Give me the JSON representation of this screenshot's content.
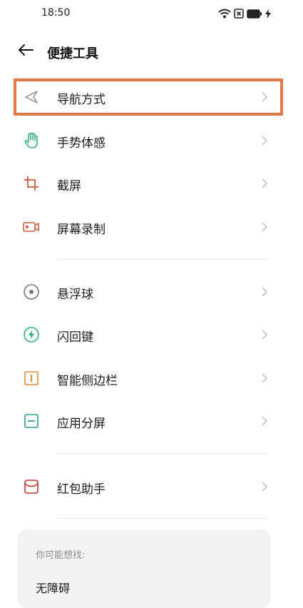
{
  "status_bar": {
    "time": "18:50",
    "icons": [
      "wifi-icon",
      "sim-x-icon",
      "battery-icon",
      "charging-icon"
    ]
  },
  "header": {
    "title": "便捷工具",
    "back_icon": "back-arrow-icon"
  },
  "menu": {
    "group1": [
      {
        "label": "导航方式",
        "icon": "navigation-arrow-icon",
        "color": "#8a8a9a"
      },
      {
        "label": "手势体感",
        "icon": "hand-gesture-icon",
        "color": "#2fae80"
      },
      {
        "label": "截屏",
        "icon": "crop-screenshot-icon",
        "color": "#d05a3a"
      },
      {
        "label": "屏幕录制",
        "icon": "screen-record-icon",
        "color": "#d05a3a"
      }
    ],
    "group2": [
      {
        "label": "悬浮球",
        "icon": "floating-ball-icon",
        "color": "#777777"
      },
      {
        "label": "闪回键",
        "icon": "flashback-key-icon",
        "color": "#2fae80"
      },
      {
        "label": "智能侧边栏",
        "icon": "smart-sidebar-icon",
        "color": "#e08a3a"
      },
      {
        "label": "应用分屏",
        "icon": "split-screen-icon",
        "color": "#2aa198"
      }
    ],
    "group3": [
      {
        "label": "红包助手",
        "icon": "red-envelope-icon",
        "color": "#c0392b"
      }
    ]
  },
  "highlight_color": "#e47a47",
  "suggestions": {
    "caption": "你可能想找:",
    "items": [
      "无障碍"
    ]
  }
}
